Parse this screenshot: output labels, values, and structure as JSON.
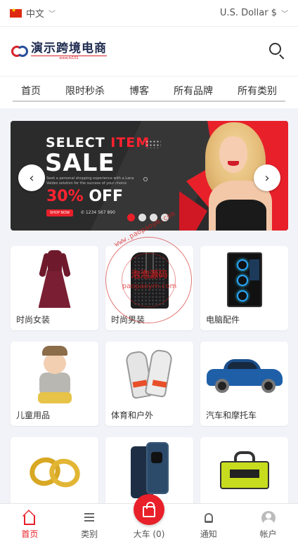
{
  "topbar": {
    "language": "中文",
    "currency": "U.S. Dollar $"
  },
  "header": {
    "logo_title": "演示跨境电商",
    "logo_sub": "www.lo101"
  },
  "nav": {
    "items": [
      "首页",
      "限时秒杀",
      "博客",
      "所有品牌",
      "所有类别"
    ]
  },
  "banner": {
    "select": "SELECT ",
    "item": "ITEM",
    "sale": "SALE",
    "description": "Seek a personal shopping experience with a Lana Valdez solution for the success of your choice",
    "off_pct": "30%",
    "off_text": " OFF",
    "shop_now": "SHOP NOW",
    "phone": "✆ 1234 567 890",
    "prev_icon": "‹",
    "next_icon": "›"
  },
  "categories": [
    {
      "label": "时尚女装",
      "icon": "dress"
    },
    {
      "label": "时尚男装",
      "icon": "suit"
    },
    {
      "label": "电脑配件",
      "icon": "pc-case"
    },
    {
      "label": "儿童用品",
      "icon": "baby"
    },
    {
      "label": "体育和户外",
      "icon": "gloves"
    },
    {
      "label": "汽车和摩托车",
      "icon": "car"
    },
    {
      "label": "",
      "icon": "rings"
    },
    {
      "label": "",
      "icon": "phone"
    },
    {
      "label": "",
      "icon": "tool-bag"
    }
  ],
  "watermark": {
    "top": "www.paopaoym.com",
    "center": "泡泡源码",
    "bottom": "paopaoym.com"
  },
  "bottom_nav": {
    "home": "首页",
    "category": "类别",
    "cart": "大车 (0)",
    "notify": "通知",
    "account": "帐户"
  },
  "colors": {
    "accent": "#e8202a",
    "logo_blue": "#1e2b4f"
  }
}
